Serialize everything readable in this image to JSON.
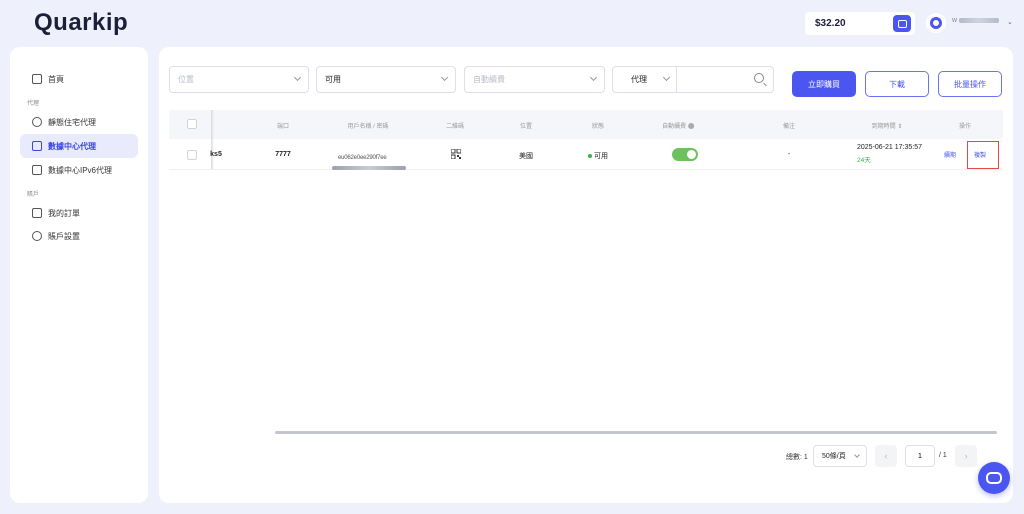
{
  "header": {
    "logo_text": "Quarkip",
    "balance": "$32.20",
    "user_name": "w"
  },
  "sidebar": {
    "items": [
      {
        "label": "首頁"
      },
      {
        "label": "靜態住宅代理"
      },
      {
        "label": "數據中心代理"
      },
      {
        "label": "數據中心IPv6代理"
      },
      {
        "label": "我的訂單"
      },
      {
        "label": "賬戶設置"
      }
    ],
    "sections": [
      "代理",
      "賬戶"
    ]
  },
  "filters": {
    "location_placeholder": "位置",
    "status_value": "可用",
    "autorenew_placeholder": "自動續費",
    "search_type": "代理",
    "search_value": ""
  },
  "actions": {
    "buy_now": "立即購買",
    "download": "下載",
    "batch": "批量操作"
  },
  "table": {
    "columns": [
      "端口",
      "用戶名稱 / 密碼",
      "二維碼",
      "位置",
      "狀態",
      "自動續費",
      "備注",
      "到期時間",
      "操作"
    ],
    "rows": [
      {
        "protocol": "ks5",
        "port": "7777",
        "credential_line1": "eu062e0ee290f7ee",
        "location": "美國",
        "status": "可用",
        "note": "-",
        "expiry": "2025-06-21 17:35:57",
        "days_left": "24天",
        "edit": "續期",
        "copy": "複製"
      }
    ]
  },
  "pagination": {
    "total_label": "總數: 1",
    "page_size": "50條/頁",
    "current_page": "1",
    "of_pages": "/ 1",
    "prev": "‹",
    "next": "›"
  },
  "colors": {
    "accent": "#4b56f0",
    "success": "#3bb34a",
    "highlight": "#e34b3c"
  }
}
